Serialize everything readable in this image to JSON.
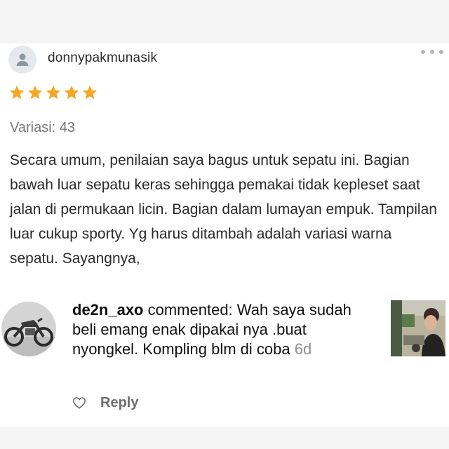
{
  "review": {
    "username": "donnypakmunasik",
    "rating": 5,
    "max_rating": 5,
    "variant": "Variasi: 43",
    "text": "Secara umum, penilaian saya bagus untuk sepatu ini. Bagian bawah luar sepatu keras sehingga pemakai tidak kepleset saat jalan di permukaan licin. Bagian dalam lumayan empuk. Tampilan luar cukup sporty. Yg harus ditambah adalah variasi warna sepatu. Sayangnya,",
    "star_color": "#f5a623"
  },
  "comment": {
    "username": "de2n_axo",
    "action": " commented: ",
    "text": "Wah saya sudah beli emang enak dipakai nya .buat nyongkel. Kompling blm di coba",
    "time": "6d",
    "reply_label": "Reply"
  },
  "icons": {
    "user_avatar": "person-icon",
    "more": "more-dots-icon",
    "like": "heart-icon"
  }
}
